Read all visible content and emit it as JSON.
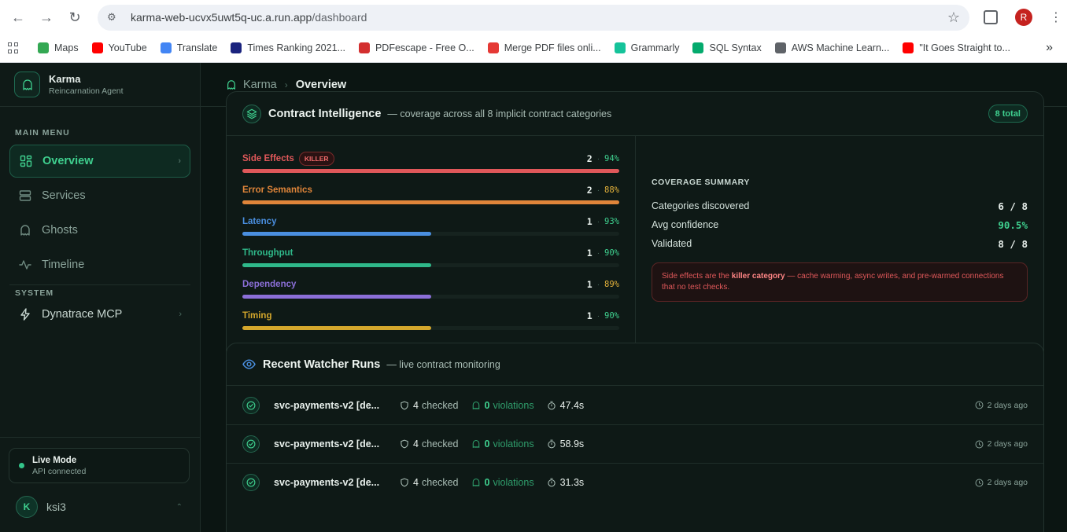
{
  "browser": {
    "url_host": "karma-web-ucvx5uwt5q-uc.a.run.app",
    "url_path": "/dashboard",
    "profile_initial": "R",
    "bookmarks": [
      {
        "label": "Maps",
        "color": "#34a853"
      },
      {
        "label": "YouTube",
        "color": "#ff0000"
      },
      {
        "label": "Translate",
        "color": "#4285f4"
      },
      {
        "label": "Times Ranking 2021...",
        "color": "#1a237e"
      },
      {
        "label": "PDFescape - Free O...",
        "color": "#d32f2f"
      },
      {
        "label": "Merge PDF files onli...",
        "color": "#e53935"
      },
      {
        "label": "Grammarly",
        "color": "#15c39a"
      },
      {
        "label": "SQL Syntax",
        "color": "#04aa6d"
      },
      {
        "label": "AWS Machine Learn...",
        "color": "#5f6368"
      },
      {
        "label": "\"It Goes Straight to...",
        "color": "#ff0000"
      }
    ]
  },
  "brand": {
    "name": "Karma",
    "subtitle": "Reincarnation Agent"
  },
  "sidebar": {
    "main_menu_label": "MAIN MENU",
    "items": [
      {
        "label": "Overview"
      },
      {
        "label": "Services"
      },
      {
        "label": "Ghosts"
      },
      {
        "label": "Timeline"
      }
    ],
    "system_label": "SYSTEM",
    "system_items": [
      {
        "label": "Dynatrace MCP"
      }
    ],
    "live": {
      "title": "Live Mode",
      "subtitle": "API connected"
    },
    "user": {
      "initial": "K",
      "name": "ksi3"
    }
  },
  "breadcrumb": {
    "root": "Karma",
    "current": "Overview"
  },
  "contract": {
    "title": "Contract Intelligence",
    "subtitle": "— coverage across all 8 implicit contract categories",
    "badge": "8 total",
    "categories": [
      {
        "name": "Side Effects",
        "count": "2",
        "pct": "94%",
        "fill": 1.0,
        "color": "#e0585a",
        "pct_color": "#3fd08f",
        "tag": "KILLER"
      },
      {
        "name": "Error Semantics",
        "count": "2",
        "pct": "88%",
        "fill": 1.0,
        "color": "#e0853a",
        "pct_color": "#e3b13b"
      },
      {
        "name": "Latency",
        "count": "1",
        "pct": "93%",
        "fill": 0.5,
        "color": "#4a8fe0",
        "pct_color": "#3fd08f"
      },
      {
        "name": "Throughput",
        "count": "1",
        "pct": "90%",
        "fill": 0.5,
        "color": "#2fb98a",
        "pct_color": "#3fd08f"
      },
      {
        "name": "Dependency",
        "count": "1",
        "pct": "89%",
        "fill": 0.5,
        "color": "#8b6fd8",
        "pct_color": "#e3b13b"
      },
      {
        "name": "Timing",
        "count": "1",
        "pct": "90%",
        "fill": 0.5,
        "color": "#d4a72c",
        "pct_color": "#3fd08f"
      }
    ],
    "summary": {
      "label": "COVERAGE SUMMARY",
      "rows": [
        {
          "label": "Categories discovered",
          "value": "6 / 8"
        },
        {
          "label": "Avg confidence",
          "value": "90.5%"
        },
        {
          "label": "Validated",
          "value": "8 / 8"
        }
      ],
      "note_pre": "Side effects are the",
      "note_bold": "killer category",
      "note_post": "— cache warming, async writes, and pre-warmed connections that no test checks."
    }
  },
  "watcher": {
    "title": "Recent Watcher Runs",
    "subtitle": "— live contract monitoring",
    "runs": [
      {
        "name": "svc-payments-v2 [de...",
        "checked": "4",
        "checked_label": "checked",
        "violations": "0",
        "violations_label": "violations",
        "duration": "47.4s",
        "ago": "2 days ago"
      },
      {
        "name": "svc-payments-v2 [de...",
        "checked": "4",
        "checked_label": "checked",
        "violations": "0",
        "violations_label": "violations",
        "duration": "58.9s",
        "ago": "2 days ago"
      },
      {
        "name": "svc-payments-v2 [de...",
        "checked": "4",
        "checked_label": "checked",
        "violations": "0",
        "violations_label": "violations",
        "duration": "31.3s",
        "ago": "2 days ago"
      }
    ]
  }
}
